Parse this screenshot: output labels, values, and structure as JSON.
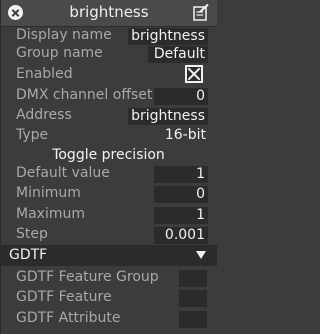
{
  "window": {
    "title": "brightness",
    "close_icon": "close-icon",
    "edit_icon": "edit-icon"
  },
  "properties": {
    "display_name": {
      "label": "Display name",
      "value": "brightness"
    },
    "group_name": {
      "label": "Group name",
      "value": "Default"
    },
    "enabled": {
      "label": "Enabled",
      "checked": true
    },
    "dmx_channel_offset": {
      "label": "DMX channel offset",
      "value": "0"
    },
    "address": {
      "label": "Address",
      "value": "brightness"
    },
    "type": {
      "label": "Type",
      "value": "16-bit"
    }
  },
  "precision": {
    "heading": "Toggle precision",
    "default_value": {
      "label": "Default value",
      "value": "1"
    },
    "minimum": {
      "label": "Minimum",
      "value": "0"
    },
    "maximum": {
      "label": "Maximum",
      "value": "1"
    },
    "step": {
      "label": "Step",
      "value": "0.001"
    }
  },
  "gdtf": {
    "section_label": "GDTF",
    "feature_group": {
      "label": "GDTF Feature Group",
      "value": ""
    },
    "feature": {
      "label": "GDTF Feature",
      "value": ""
    },
    "attribute": {
      "label": "GDTF Attribute",
      "value": ""
    }
  },
  "colors": {
    "panel_bg": "#3c3c3c",
    "field_bg": "#2b2b2b",
    "label": "#a9a9a9",
    "value": "#f2f2f2"
  }
}
